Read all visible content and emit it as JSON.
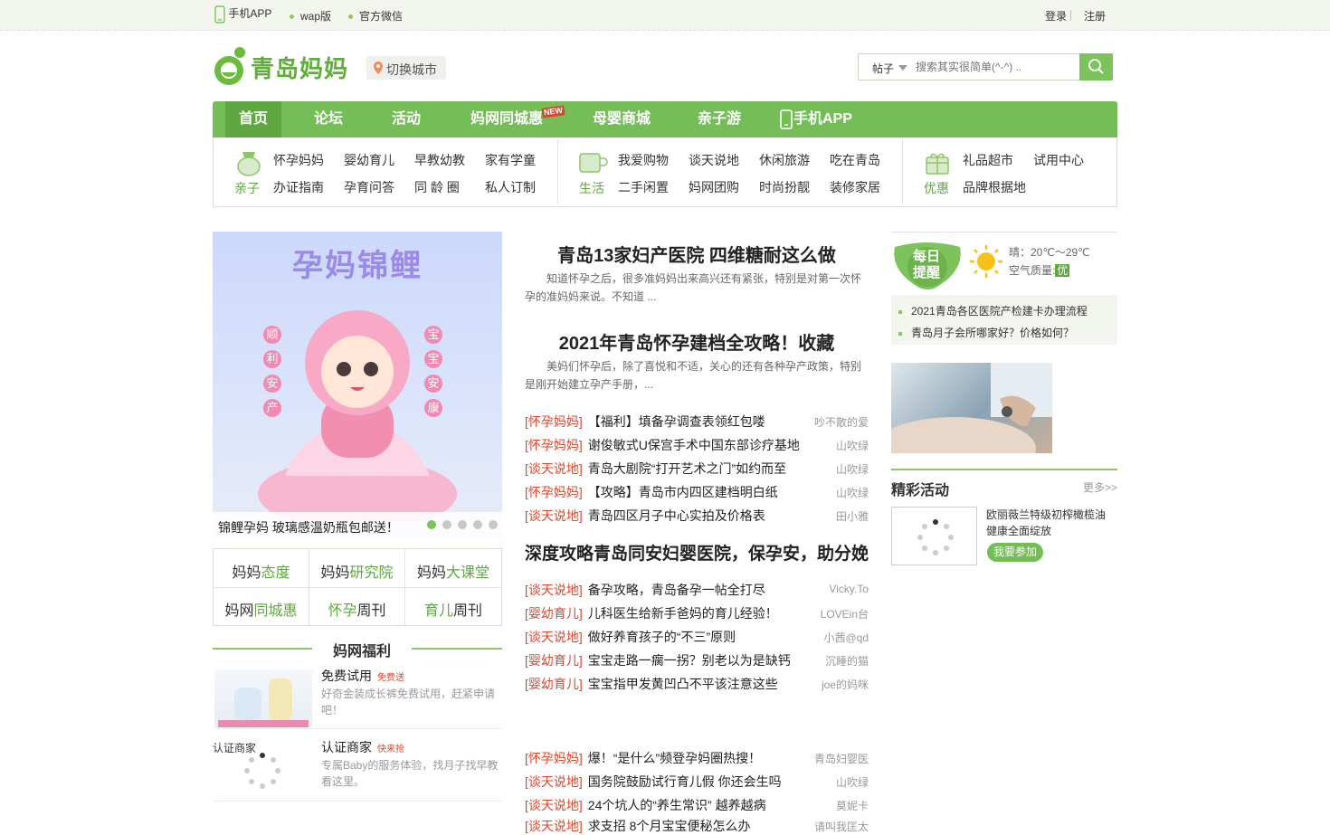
{
  "topbar": {
    "app": "手机APP",
    "wap": "wap版",
    "wechat": "官方微信",
    "login": "登录",
    "sep": "|",
    "register": "注册"
  },
  "header": {
    "logo_text": "青岛妈妈",
    "city_label": "切换城市",
    "search_category": "帖子",
    "search_placeholder": "搜索其实很简单(^-^) ..",
    "search_icon": "search-icon"
  },
  "nav": {
    "items": [
      "首页",
      "论坛",
      "活动",
      "妈网同城惠",
      "母婴商城",
      "亲子游",
      "手机APP"
    ],
    "new_badge": "NEW"
  },
  "subnav": {
    "groups": [
      {
        "label": "亲子",
        "icon": "baby-bottle-icon",
        "links": [
          "怀孕妈妈",
          "婴幼育儿",
          "早教幼教",
          "家有学童",
          "办证指南",
          "孕育问答",
          "同 龄 圈",
          "私人订制"
        ]
      },
      {
        "label": "生活",
        "icon": "cup-icon",
        "links": [
          "我爱购物",
          "谈天说地",
          "休闲旅游",
          "吃在青岛",
          "二手闲置",
          "妈网团购",
          "时尚扮靓",
          "装修家居"
        ]
      },
      {
        "label": "优惠",
        "icon": "gift-icon",
        "links": [
          "礼品超市",
          "试用中心",
          "品牌根据地"
        ]
      }
    ]
  },
  "banner": {
    "title": "孕妈锦鲤",
    "left_words": [
      "顺",
      "利",
      "安",
      "产"
    ],
    "right_words": [
      "宝",
      "宝",
      "安",
      "康"
    ],
    "caption": "锦鲤孕妈 玻璃感温奶瓶包邮送！",
    "slides": 5,
    "active_slide": 0
  },
  "grid": [
    {
      "pre": "妈妈",
      "em": "态度",
      "post": ""
    },
    {
      "pre": "妈妈",
      "em": "研究院",
      "post": ""
    },
    {
      "pre": "妈妈",
      "em": "大课堂",
      "post": ""
    },
    {
      "pre": "妈网",
      "em": "同城惠",
      "post": ""
    },
    {
      "pre": "",
      "em": "怀孕",
      "post": "周刊"
    },
    {
      "pre": "",
      "em": "育儿",
      "post": "周刊"
    }
  ],
  "welfare": {
    "title": "妈网福利",
    "cards": [
      {
        "title": "免费试用",
        "tag": "免费送",
        "desc": [
          "好奇金装成长裤免费试用，赶紧申请",
          "吧！"
        ]
      },
      {
        "title": "认证商家",
        "tag": "快来抢",
        "img_alt": "认证商家",
        "desc": [
          "专属Baby的服务体验，找月子找早教",
          "看这里。"
        ]
      }
    ]
  },
  "main": {
    "features": [
      {
        "title": "青岛13家妇产医院 四维糖耐这么做",
        "desc": "知道怀孕之后，很多准妈妈出来高兴还有紧张，特别是对第一次怀孕的准妈妈来说。不知道 ..."
      },
      {
        "title": "2021年青岛怀孕建档全攻略！收藏",
        "desc": "美妈们怀孕后，除了喜悦和不适，关心的还有各种孕产政策，特别是刚开始建立孕产手册，..."
      }
    ],
    "list1": [
      {
        "tag": "[怀孕妈妈]",
        "title": "【福利】填备孕调查表领红包喽",
        "author": "吵不散的爱"
      },
      {
        "tag": "[怀孕妈妈]",
        "title": "谢俊敏式U保宫手术中国东部诊疗基地",
        "author": "山吹绿"
      },
      {
        "tag": "[谈天说地]",
        "title": "青岛大剧院“打开艺术之门”如约而至",
        "author": "山吹绿"
      },
      {
        "tag": "[怀孕妈妈]",
        "title": "【攻略】青岛市内四区建档明白纸",
        "author": "山吹绿"
      },
      {
        "tag": "[谈天说地]",
        "title": "青岛四区月子中心实拍及价格表",
        "author": "田小雅"
      }
    ],
    "feature3": "深度攻略青岛同安妇婴医院，保孕安，助分娩",
    "list2": [
      {
        "tag": "[谈天说地]",
        "title": "备孕攻略，青岛备孕一帖全打尽",
        "author": "Vicky.To"
      },
      {
        "tag": "[婴幼育儿]",
        "title": "儿科医生给新手爸妈的育儿经验！",
        "author": "LOVEin台"
      },
      {
        "tag": "[谈天说地]",
        "title": "做好养育孩子的“不三”原则",
        "author": "小茜@qd"
      },
      {
        "tag": "[婴幼育儿]",
        "title": "宝宝走路一瘸一拐？别老以为是缺钙",
        "author": "沉睡的猫"
      },
      {
        "tag": "[婴幼育儿]",
        "title": "宝宝指甲发黄凹凸不平该注意这些",
        "author": "joe的妈咪"
      }
    ],
    "list3": [
      {
        "tag": "[怀孕妈妈]",
        "title": "爆！“是什么”频登孕妈圈热搜！",
        "author": "青岛妇婴医"
      },
      {
        "tag": "[谈天说地]",
        "title": "国务院鼓励试行育儿假 你还会生吗",
        "author": "山吹绿"
      },
      {
        "tag": "[谈天说地]",
        "title": "24个坑人的“养生常识” 越养越病",
        "author": "莫妮卡"
      },
      {
        "tag": "[谈天说地]",
        "title": "求支招 8个月宝宝便秘怎么办",
        "author": "请叫我匡太"
      }
    ]
  },
  "sidebar": {
    "remind_title": [
      "每日",
      "提醒"
    ],
    "weather": "晴：20℃～29℃",
    "air_label": "空气质量:",
    "air_value": "优",
    "notices": [
      "2021青岛各区医院产检建卡办理流程",
      "青岛月子会所哪家好？价格如何？"
    ],
    "activity_title": "精彩活动",
    "more": "更多>>",
    "activity": {
      "desc": [
        "欧丽薇兰特级初榨橄榄油",
        "健康全面绽放"
      ],
      "button": "我要参加"
    }
  },
  "colors": {
    "brand_green": "#74bd57",
    "dark_green": "#5ea741",
    "tag_red": "#e0452c"
  }
}
